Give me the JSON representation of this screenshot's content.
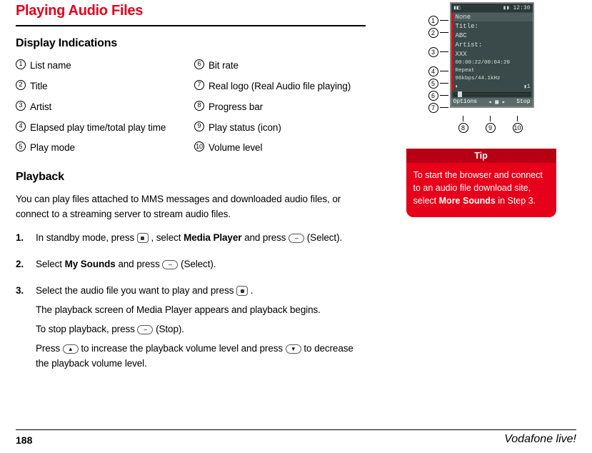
{
  "page_title": "Playing Audio Files",
  "section_display": "Display Indications",
  "indications": {
    "left": [
      {
        "num": "1",
        "label": "List name"
      },
      {
        "num": "2",
        "label": "Title"
      },
      {
        "num": "3",
        "label": "Artist"
      },
      {
        "num": "4",
        "label": "Elapsed play time/total play time"
      },
      {
        "num": "5",
        "label": "Play mode"
      }
    ],
    "right": [
      {
        "num": "6",
        "label": "Bit rate"
      },
      {
        "num": "7",
        "label": "Real logo (Real Audio file playing)"
      },
      {
        "num": "8",
        "label": "Progress bar"
      },
      {
        "num": "9",
        "label": "Play status (icon)"
      },
      {
        "num": "10",
        "label": "Volume level"
      }
    ]
  },
  "section_playback": "Playback",
  "playback_intro": "You can play files attached to MMS messages and downloaded audio files, or connect to a streaming server to stream audio files.",
  "steps": {
    "s1": {
      "num": "1.",
      "a": "In standby mode, press ",
      "b": ", select ",
      "c": "Media Player",
      "d": " and press ",
      "key2": "–",
      "e": " (Select)."
    },
    "s2": {
      "num": "2.",
      "a": "Select ",
      "b": "My Sounds",
      "c": " and press ",
      "key": "–",
      "d": " (Select)."
    },
    "s3": {
      "num": "3.",
      "a": "Select the audio file you want to play and press ",
      "b": ".",
      "sub1": "The playback screen of Media Player appears and playback begins.",
      "sub2a": "To stop playback, press ",
      "sub2key": "–",
      "sub2b": " (Stop).",
      "sub3a": "Press ",
      "sub3key1": "▴",
      "sub3b": " to increase the playback volume level and press ",
      "sub3key2": "▾",
      "sub3c": " to decrease the playback volume level."
    }
  },
  "tip": {
    "header": "Tip",
    "body_a": "To start the browser and connect to an audio file download site, select ",
    "body_b": "More Sounds",
    "body_c": " in Step 3."
  },
  "screen": {
    "status_left": "▮◧",
    "status_right": "▮▮ 12:30",
    "list_name": "None",
    "title_label": "Title:",
    "title_value": "ABC",
    "artist_label": "Artist:",
    "artist_value": "XXX",
    "time": "00:00:22/00:04:20",
    "mode": "Repeat",
    "rate": "96kbps/44.1kHz",
    "real_mark": "◐",
    "vol_num": "1",
    "soft_left": "Options",
    "soft_mid": "◂ ▦ ▸",
    "soft_right": "Stop"
  },
  "callout_nums": {
    "c1": "1",
    "c2": "2",
    "c3": "3",
    "c4": "4",
    "c5": "5",
    "c6": "6",
    "c7": "7",
    "c8": "8",
    "c9": "9",
    "c10": "10"
  },
  "footer": {
    "page": "188",
    "brand": "Vodafone live!"
  }
}
